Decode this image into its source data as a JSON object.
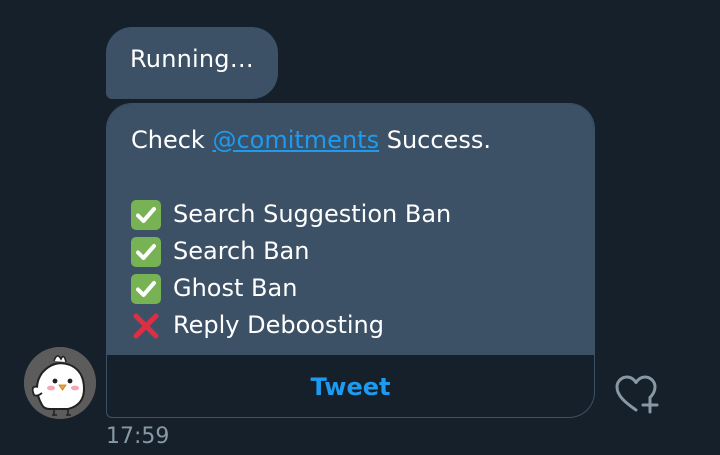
{
  "messages": {
    "status": "Running…",
    "card": {
      "intro_prefix": "Check",
      "mention": "@comitments",
      "intro_suffix": "Success.",
      "checks": [
        {
          "label": "Search Suggestion Ban",
          "icon": "check-mark-button-icon"
        },
        {
          "label": "Search Ban",
          "icon": "check-mark-button-icon"
        },
        {
          "label": "Ghost Ban",
          "icon": "check-mark-button-icon"
        },
        {
          "label": "Reply Deboosting",
          "icon": "cross-mark-icon"
        }
      ],
      "button_label": "Tweet"
    },
    "timestamp": "17:59"
  },
  "icons": {
    "like": "heart-plus-icon",
    "avatar": "chick-avatar"
  },
  "colors": {
    "background": "#15202b",
    "bubble": "#3d5166",
    "accent": "#1d9bf0",
    "check_green": "#77b255",
    "cross_red": "#dd2e44",
    "muted_text": "#8899a6"
  }
}
